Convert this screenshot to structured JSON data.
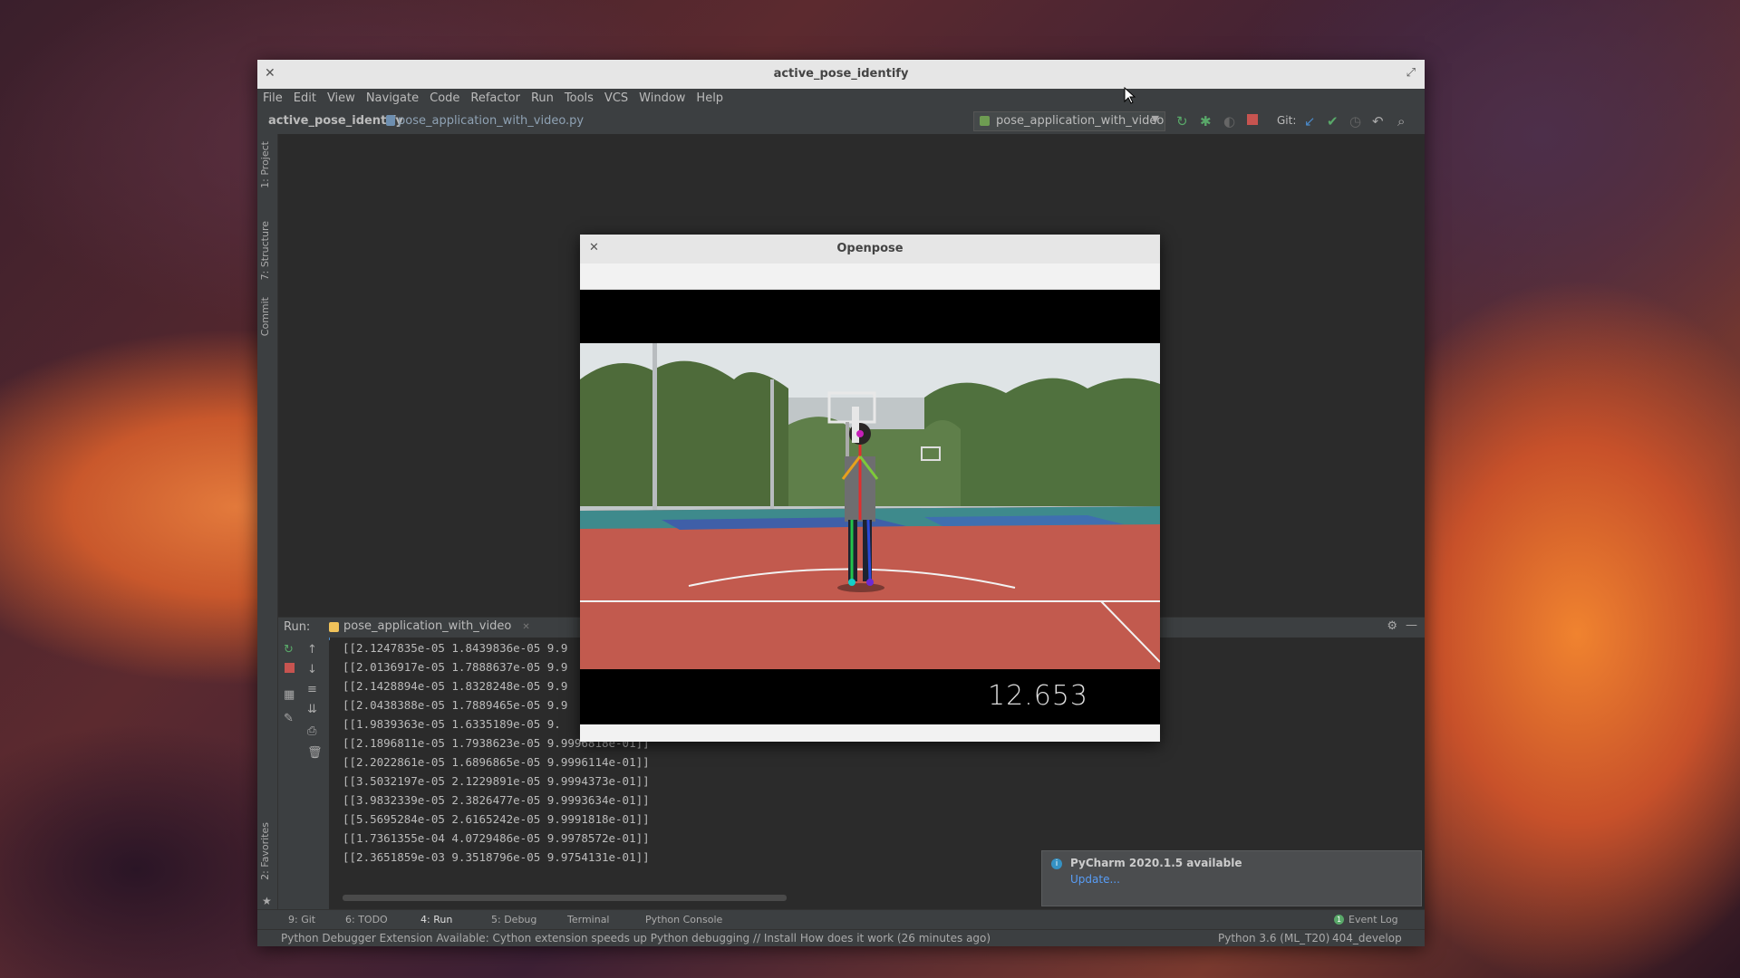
{
  "ide": {
    "window_title": "active_pose_identify",
    "menu": [
      "File",
      "Edit",
      "View",
      "Navigate",
      "Code",
      "Refactor",
      "Run",
      "Tools",
      "VCS",
      "Window",
      "Help"
    ],
    "breadcrumb": {
      "project": "active_pose_identify",
      "file": "pose_application_with_video.py"
    },
    "run_config": "pose_application_with_video",
    "git_label": "Git:",
    "left_tabs": {
      "project": "1: Project",
      "structure": "7: Structure",
      "commit": "Commit",
      "favorites": "2: Favorites"
    },
    "run_panel": {
      "label": "Run:",
      "tab": "pose_application_with_video",
      "lines": [
        "[[2.1247835e-05 1.8439836e-05 9.9",
        "[[2.0136917e-05 1.7888637e-05 9.9",
        "[[2.1428894e-05 1.8328248e-05 9.9",
        "[[2.0438388e-05 1.7889465e-05 9.9",
        "[[1.9839363e-05 1.6335189e-05 9.",
        "[[2.1896811e-05 1.7938623e-05 9.9996818e-01]]",
        "[[2.2022861e-05 1.6896865e-05 9.9996114e-01]]",
        "[[3.5032197e-05 2.1229891e-05 9.9994373e-01]]",
        "[[3.9832339e-05 2.3826477e-05 9.9993634e-01]]",
        "[[5.5695284e-05 2.6165242e-05 9.9991818e-01]]",
        "[[1.7361355e-04 4.0729486e-05 9.9978572e-01]]",
        "[[2.3651859e-03 9.3518796e-05 9.9754131e-01]]"
      ]
    },
    "bottom_tabs": [
      "9: Git",
      "6: TODO",
      "4: Run",
      "5: Debug",
      "Terminal",
      "Python Console"
    ],
    "event_log": "Event Log",
    "event_log_count": "1",
    "status": {
      "message": "Python Debugger Extension Available: Cython extension speeds up Python debugging // Install   How does it work (26 minutes ago)",
      "interpreter": "Python 3.6 (ML_T20)",
      "branch": "404_develop"
    },
    "notification": {
      "title": "PyCharm 2020.1.5 available",
      "link": "Update..."
    }
  },
  "openpose": {
    "title": "Openpose",
    "timer": "12.653"
  },
  "colors": {
    "accent": "#4a88c7",
    "link": "#589df6",
    "run_green": "#59a869",
    "stop_red": "#c75450"
  }
}
